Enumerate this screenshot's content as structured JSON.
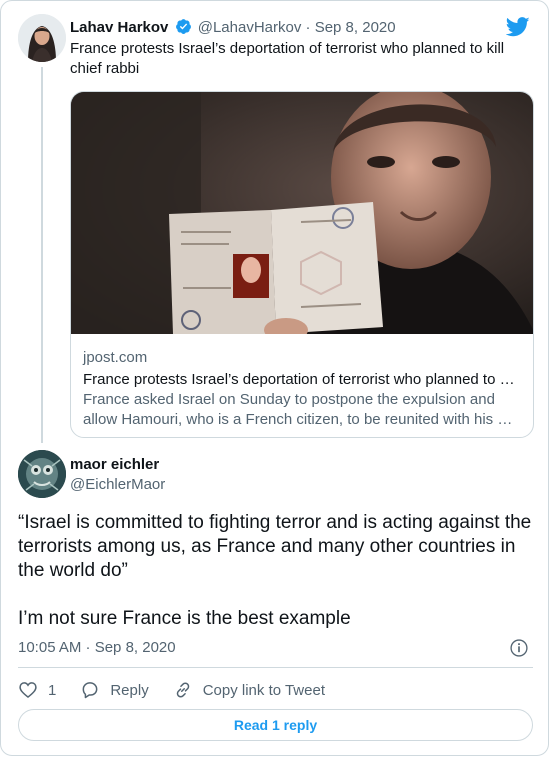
{
  "parent_tweet": {
    "author_name": "Lahav Harkov",
    "author_handle": "@LahavHarkov",
    "separator": "·",
    "date": "Sep 8, 2020",
    "text": "France protests Israel’s deportation of terrorist who planned to kill chief rabbi",
    "verified": true,
    "link_card": {
      "domain": "jpost.com",
      "title": "France protests Israel’s deportation of terrorist who planned to …",
      "description_line1": "France asked Israel on Sunday to postpone the expulsion and",
      "description_line2": "allow Hamouri, who is a French citizen, to be reunited with his …"
    }
  },
  "main_tweet": {
    "author_name": "maor eichler",
    "author_handle": "@EichlerMaor",
    "text_line1": "“Israel is committed to fighting terror and is acting against the terrorists among us, as France and many other countries in the world do”",
    "text_line2": "I’m not sure France is the best example",
    "timestamp": "10:05 AM · Sep 8, 2020",
    "like_count": "1",
    "reply_label": "Reply",
    "copy_link_label": "Copy link to Tweet",
    "read_replies_label": "Read 1 reply"
  },
  "icons": {
    "brand": "twitter-bird-icon",
    "verified": "verified-badge-icon",
    "info": "info-icon",
    "like": "heart-icon",
    "reply": "reply-bubble-icon",
    "link": "link-icon"
  },
  "colors": {
    "accent": "#1d9bf0",
    "secondary_text": "#536471",
    "border": "#cfd9de",
    "primary_text": "#0f1419"
  }
}
